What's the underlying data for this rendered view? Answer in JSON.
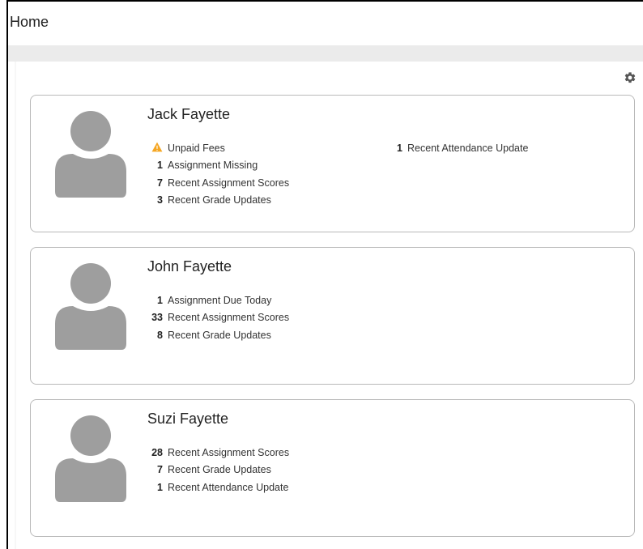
{
  "page": {
    "title": "Home"
  },
  "colors": {
    "avatar": "#9e9e9e",
    "warning": "#f5a623",
    "card_border": "#b9b9b9"
  },
  "settings_icon": "gear-icon",
  "students": [
    {
      "name": "Jack Fayette",
      "items": [
        {
          "count": "",
          "icon": "warning-icon",
          "label": "Unpaid Fees"
        },
        {
          "count": "1",
          "label": "Assignment Missing"
        },
        {
          "count": "7",
          "label": "Recent Assignment Scores"
        },
        {
          "count": "3",
          "label": "Recent Grade Updates"
        }
      ],
      "items_col2": [
        {
          "count": "1",
          "label": "Recent Attendance Update"
        }
      ]
    },
    {
      "name": "John Fayette",
      "items": [
        {
          "count": "1",
          "label": "Assignment Due Today"
        },
        {
          "count": "33",
          "label": "Recent Assignment Scores"
        },
        {
          "count": "8",
          "label": "Recent Grade Updates"
        }
      ]
    },
    {
      "name": "Suzi Fayette",
      "items": [
        {
          "count": "28",
          "label": "Recent Assignment Scores"
        },
        {
          "count": "7",
          "label": "Recent Grade Updates"
        },
        {
          "count": "1",
          "label": "Recent Attendance Update"
        }
      ]
    }
  ]
}
